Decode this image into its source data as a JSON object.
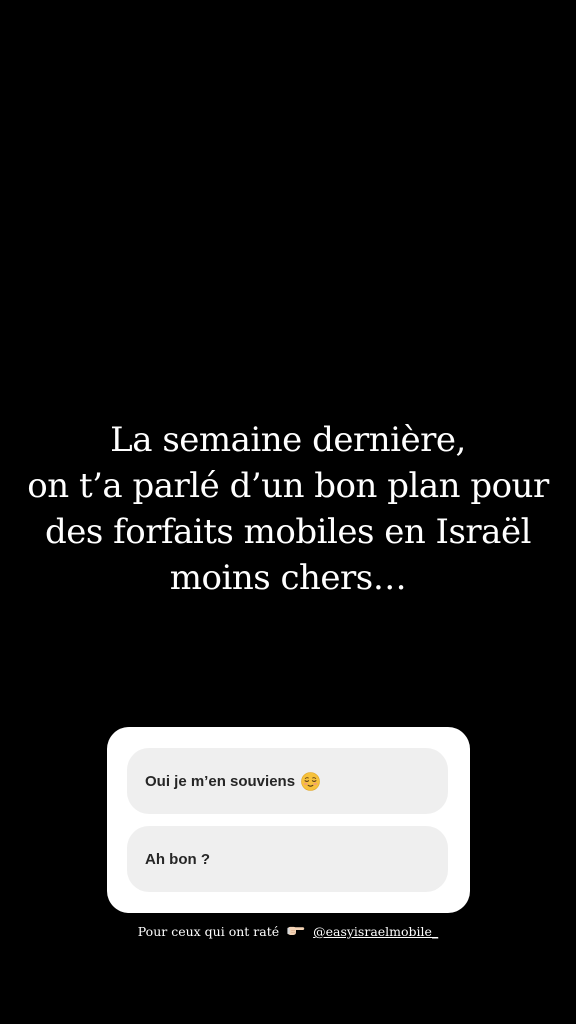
{
  "story": {
    "headline_lines": [
      "La semaine dernière,",
      "on t’a parlé d’un bon plan pour",
      "des forfaits mobiles en Israël",
      "moins chers…"
    ]
  },
  "poll": {
    "options": [
      {
        "label": "Oui je m’en souviens",
        "icon": "relieved-face-emoji"
      },
      {
        "label": "Ah bon ?"
      }
    ]
  },
  "caption": {
    "text": "Pour ceux qui ont raté",
    "icon": "pointing-right-hand-emoji",
    "mention": "@easyisraelmobile_"
  },
  "colors": {
    "background": "#000000",
    "text": "#ffffff",
    "poll_card": "#ffffff",
    "poll_option": "#efefef",
    "poll_option_text": "#262626"
  }
}
